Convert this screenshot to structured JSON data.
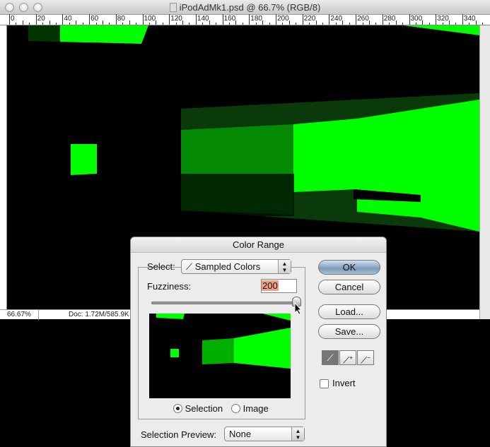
{
  "window": {
    "title": "iPodAdMk1.psd @ 66.7% (RGB/8)"
  },
  "ruler": {
    "labels": [
      "0",
      "20",
      "40",
      "60",
      "80",
      "100",
      "120",
      "140",
      "160",
      "180",
      "200",
      "220",
      "240",
      "260",
      "280",
      "300",
      "320",
      "340"
    ]
  },
  "status": {
    "zoom": "66.67%",
    "doc": "Doc: 1.72M/585.9K"
  },
  "dialog": {
    "title": "Color Range",
    "select_label": "Select:",
    "select_value": "Sampled Colors",
    "fuzziness_label": "Fuzziness:",
    "fuzziness_value": "200",
    "fuzziness_max": 200,
    "radio_selection": "Selection",
    "radio_image": "Image",
    "selected_radio": "Selection",
    "preview_label": "Selection Preview:",
    "preview_value": "None",
    "ok": "OK",
    "cancel": "Cancel",
    "load": "Load...",
    "save": "Save...",
    "invert": "Invert",
    "invert_checked": false,
    "eyedroppers": [
      "eyedropper-icon",
      "eyedropper-plus-icon",
      "eyedropper-minus-icon"
    ]
  },
  "colors": {
    "green": "#00ff00",
    "highlight": "#f0a080"
  }
}
